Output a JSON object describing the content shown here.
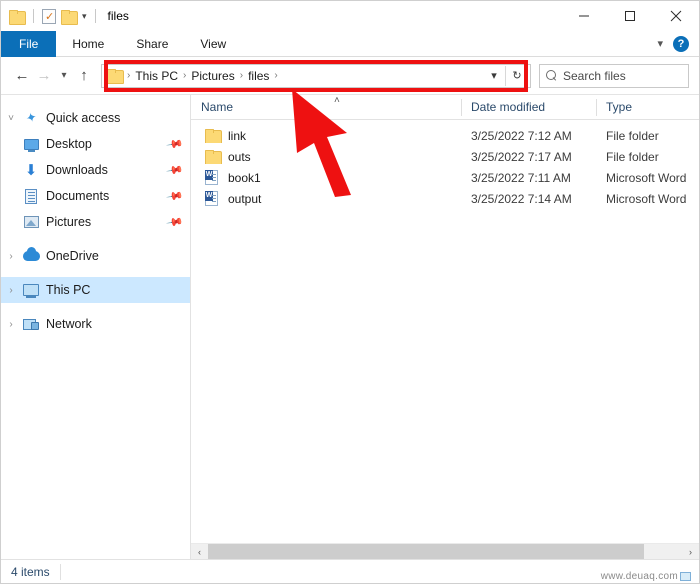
{
  "window": {
    "title": "files",
    "quick_access": [
      {
        "name": "folder-icon",
        "label": "Properties folder"
      },
      {
        "name": "properties-icon",
        "label": "Properties"
      },
      {
        "name": "new-folder-icon",
        "label": "New folder"
      },
      {
        "name": "customize-caret",
        "label": "Customize Quick Access Toolbar"
      }
    ],
    "controls": {
      "minimize": "Minimize",
      "maximize": "Maximize",
      "close": "Close"
    }
  },
  "ribbon": {
    "tabs": [
      {
        "label": "File",
        "active": true
      },
      {
        "label": "Home",
        "active": false
      },
      {
        "label": "Share",
        "active": false
      },
      {
        "label": "View",
        "active": false
      }
    ],
    "collapse_label": "Minimize the Ribbon",
    "help_label": "?"
  },
  "address": {
    "back_label": "Back",
    "forward_label": "Forward",
    "recent_label": "Recent locations",
    "up_label": "Up",
    "crumbs": [
      "This PC",
      "Pictures",
      "files"
    ],
    "separator": "›",
    "dropdown_label": "Previous locations",
    "refresh_label": "Refresh"
  },
  "search": {
    "placeholder": "Search files",
    "icon": "search-icon"
  },
  "sidebar": {
    "items": [
      {
        "label": "Quick access",
        "icon": "star-pin-icon",
        "expander": "˅",
        "level": 1,
        "pinned": false,
        "selected": false
      },
      {
        "label": "Desktop",
        "icon": "desktop-icon",
        "expander": "",
        "level": 2,
        "pinned": true,
        "selected": false
      },
      {
        "label": "Downloads",
        "icon": "downloads-icon",
        "expander": "",
        "level": 2,
        "pinned": true,
        "selected": false
      },
      {
        "label": "Documents",
        "icon": "documents-icon",
        "expander": "",
        "level": 2,
        "pinned": true,
        "selected": false
      },
      {
        "label": "Pictures",
        "icon": "pictures-icon",
        "expander": "",
        "level": 2,
        "pinned": true,
        "selected": false
      },
      {
        "label": "OneDrive",
        "icon": "onedrive-cloud-icon",
        "expander": "›",
        "level": 1,
        "pinned": false,
        "selected": false
      },
      {
        "label": "This PC",
        "icon": "this-pc-icon",
        "expander": "›",
        "level": 1,
        "pinned": false,
        "selected": true
      },
      {
        "label": "Network",
        "icon": "network-icon",
        "expander": "›",
        "level": 1,
        "pinned": false,
        "selected": false
      }
    ]
  },
  "filelist": {
    "columns": [
      "Name",
      "Date modified",
      "Type"
    ],
    "sort_indicator": "˄",
    "rows": [
      {
        "name": "link",
        "date": "3/25/2022 7:12 AM",
        "type": "File folder",
        "icon": "folder-icon"
      },
      {
        "name": "outs",
        "date": "3/25/2022 7:17 AM",
        "type": "File folder",
        "icon": "folder-icon"
      },
      {
        "name": "book1",
        "date": "3/25/2022 7:11 AM",
        "type": "Microsoft Word",
        "icon": "word-document-icon"
      },
      {
        "name": "output",
        "date": "3/25/2022 7:14 AM",
        "type": "Microsoft Word",
        "icon": "word-document-icon"
      }
    ]
  },
  "scrollbar": {
    "left_arrow": "‹",
    "right_arrow": "›"
  },
  "status": {
    "item_count": "4 items"
  },
  "watermark": {
    "text": "www.deuaq.com"
  },
  "annotations": {
    "highlight_color": "#ee1111",
    "rect_target": "address-bar",
    "arrow_target": "address-bar"
  }
}
